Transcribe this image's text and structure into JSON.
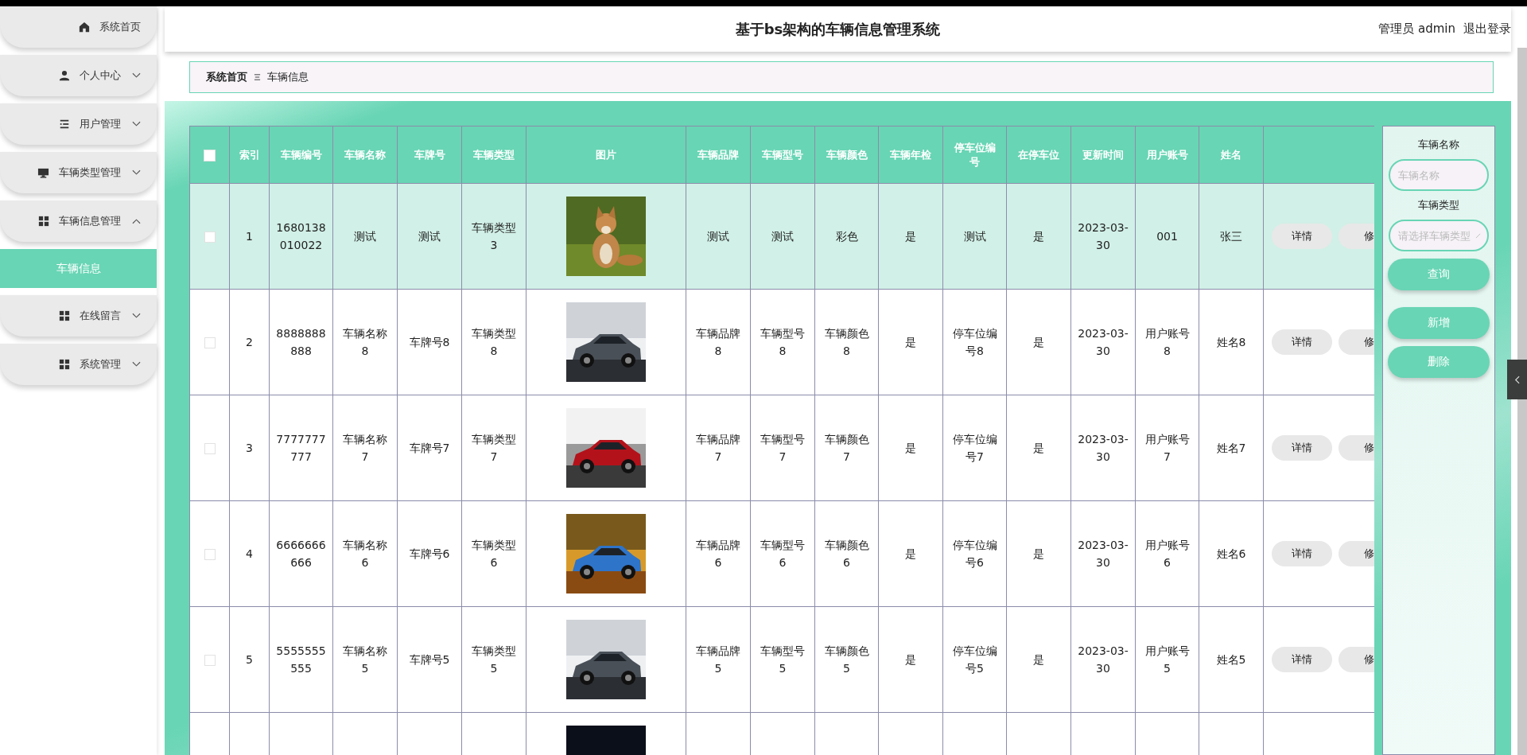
{
  "sidebar": {
    "items": [
      {
        "label": "系统首页",
        "kind": "link"
      },
      {
        "label": "个人中心",
        "kind": "menu",
        "expanded": false
      },
      {
        "label": "用户管理",
        "kind": "menu",
        "expanded": false
      },
      {
        "label": "车辆类型管理",
        "kind": "menu",
        "expanded": false
      },
      {
        "label": "车辆信息管理",
        "kind": "menu",
        "expanded": true,
        "children": [
          {
            "label": "车辆信息",
            "selected": true
          }
        ]
      },
      {
        "label": "在线留言",
        "kind": "menu",
        "expanded": false
      },
      {
        "label": "系统管理",
        "kind": "menu",
        "expanded": false
      }
    ]
  },
  "header": {
    "title": "基于bs架构的车辆信息管理系统",
    "user": "管理员 admin",
    "logout": "退出登录"
  },
  "breadcrumb": [
    "系统首页",
    "车辆信息"
  ],
  "table": {
    "select_all": false,
    "columns": [
      "索引",
      "车辆编号",
      "车辆名称",
      "车牌号",
      "车辆类型",
      "图片",
      "车辆品牌",
      "车辆型号",
      "车辆颜色",
      "车辆年检",
      "停车位编号",
      "在停车位",
      "更新时间",
      "用户账号",
      "姓名"
    ],
    "rows": [
      {
        "selected": false,
        "hovered": true,
        "picture": {
          "kind": "picture"
        },
        "cells": [
          "1",
          "1680138010022",
          "测试",
          "测试",
          "车辆类型3",
          "测试",
          "测试",
          "彩色",
          "是",
          "测试",
          "是",
          "2023-03-30",
          "001",
          "张三"
        ],
        "actions": [
          "详情",
          "修"
        ]
      },
      {
        "selected": false,
        "hovered": false,
        "picture": {
          "kind": "picture"
        },
        "cells": [
          "2",
          "8888888888",
          "车辆名称8",
          "车牌号8",
          "车辆类型8",
          "车辆品牌8",
          "车辆型号8",
          "车辆颜色8",
          "是",
          "停车位编号8",
          "是",
          "2023-03-30",
          "用户账号8",
          "姓名8"
        ],
        "actions": [
          "详情",
          "修"
        ]
      },
      {
        "selected": false,
        "hovered": false,
        "picture": {
          "kind": "picture"
        },
        "cells": [
          "3",
          "7777777777",
          "车辆名称7",
          "车牌号7",
          "车辆类型7",
          "车辆品牌7",
          "车辆型号7",
          "车辆颜色7",
          "是",
          "停车位编号7",
          "是",
          "2023-03-30",
          "用户账号7",
          "姓名7"
        ],
        "actions": [
          "详情",
          "修"
        ]
      },
      {
        "selected": false,
        "hovered": false,
        "picture": {
          "kind": "picture"
        },
        "cells": [
          "4",
          "6666666666",
          "车辆名称6",
          "车牌号6",
          "车辆类型6",
          "车辆品牌6",
          "车辆型号6",
          "车辆颜色6",
          "是",
          "停车位编号6",
          "是",
          "2023-03-30",
          "用户账号6",
          "姓名6"
        ],
        "actions": [
          "详情",
          "修"
        ]
      },
      {
        "selected": false,
        "hovered": false,
        "picture": {
          "kind": "picture"
        },
        "cells": [
          "5",
          "5555555555",
          "车辆名称5",
          "车牌号5",
          "车辆类型5",
          "车辆品牌5",
          "车辆型号5",
          "车辆颜色5",
          "是",
          "停车位编号5",
          "是",
          "2023-03-30",
          "用户账号5",
          "姓名5"
        ],
        "actions": [
          "详情",
          "修"
        ]
      },
      {
        "picture": {
          "kind": "picture"
        }
      }
    ]
  },
  "search": {
    "fields": [
      {
        "label": "车辆名称",
        "placeholder": "车辆名称",
        "kind": "input"
      },
      {
        "label": "车辆类型",
        "placeholder": "请选择车辆类型",
        "kind": "select"
      }
    ],
    "buttons": [
      "查询",
      "新增",
      "删除"
    ]
  }
}
